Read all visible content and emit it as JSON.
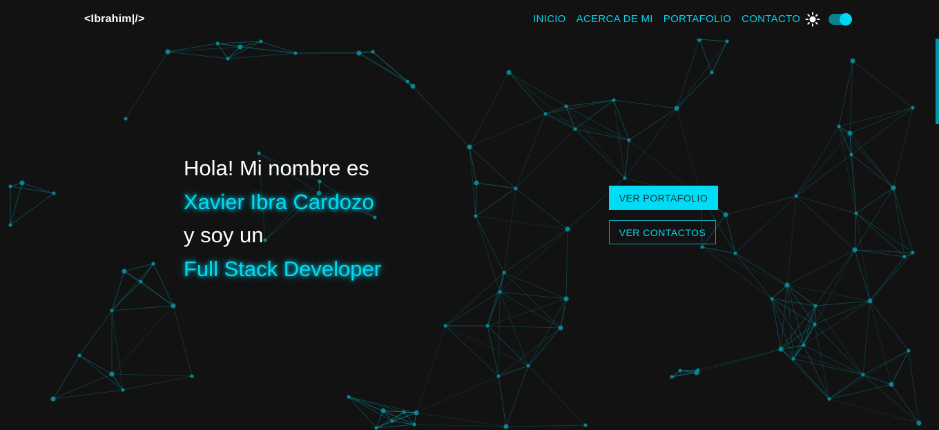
{
  "brand": {
    "logo": "<Ibrahim|/>"
  },
  "nav": {
    "links": [
      "INICIO",
      "ACERCA DE MI",
      "PORTAFOLIO",
      "CONTACTO"
    ]
  },
  "theme": {
    "icon": "sun-icon",
    "toggle_on": true
  },
  "hero": {
    "line1": "Hola! Mi nombre es",
    "name": "Xavier Ibra Cardozo",
    "line3": "y soy un",
    "role": "Full Stack Developer"
  },
  "buttons": {
    "portfolio": "VER PORTAFOLIO",
    "contacts": "VER CONTACTOS"
  },
  "colors": {
    "background": "#121212",
    "accent": "#00dcf5",
    "particle": "#0a8f9c"
  }
}
